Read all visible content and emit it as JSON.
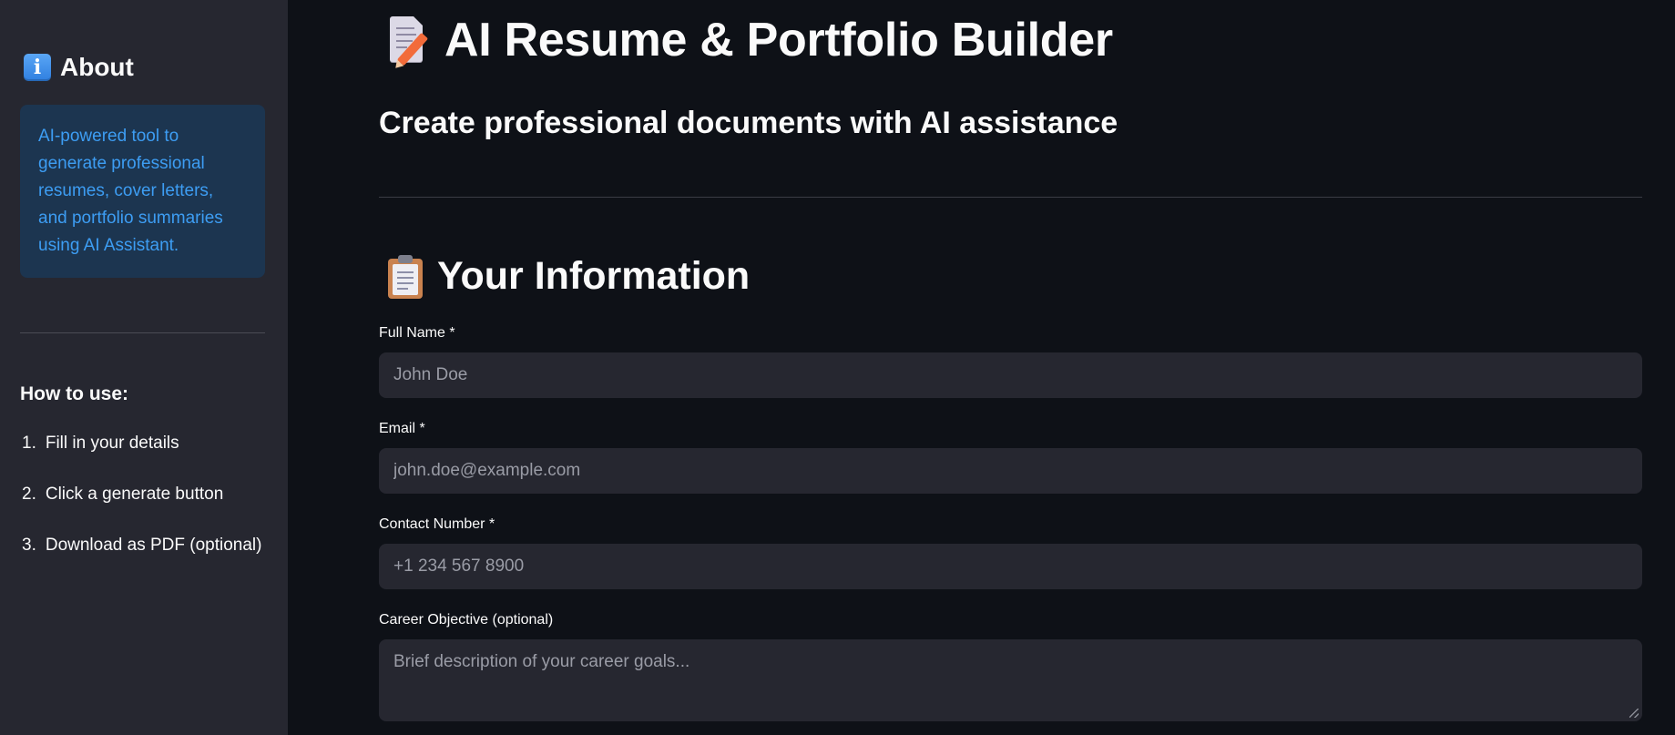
{
  "sidebar": {
    "about_title": "About",
    "info_icon": "info-icon",
    "info_text": "AI-powered tool to generate professional resumes, cover letters, and portfolio summaries using AI Assistant.",
    "howto_title": "How to use:",
    "steps": [
      {
        "num": "1.",
        "text": "Fill in your details"
      },
      {
        "num": "2.",
        "text": "Click a generate button"
      },
      {
        "num": "3.",
        "text": "Download as PDF (optional)"
      }
    ]
  },
  "main": {
    "title": "AI Resume & Portfolio Builder",
    "title_icon": "memo-icon",
    "subtitle": "Create professional documents with AI assistance",
    "section_title": "Your Information",
    "section_icon": "clipboard-icon",
    "fields": {
      "full_name": {
        "label": "Full Name *",
        "placeholder": "John Doe"
      },
      "email": {
        "label": "Email *",
        "placeholder": "john.doe@example.com"
      },
      "contact": {
        "label": "Contact Number *",
        "placeholder": "+1 234 567 8900"
      },
      "objective": {
        "label": "Career Objective (optional)",
        "placeholder": "Brief description of your career goals..."
      }
    }
  },
  "colors": {
    "background": "#0e1117",
    "sidebar": "#262730",
    "input_bg": "#262730",
    "info_box_bg": "#1c3550",
    "info_text": "#3d9df3"
  }
}
